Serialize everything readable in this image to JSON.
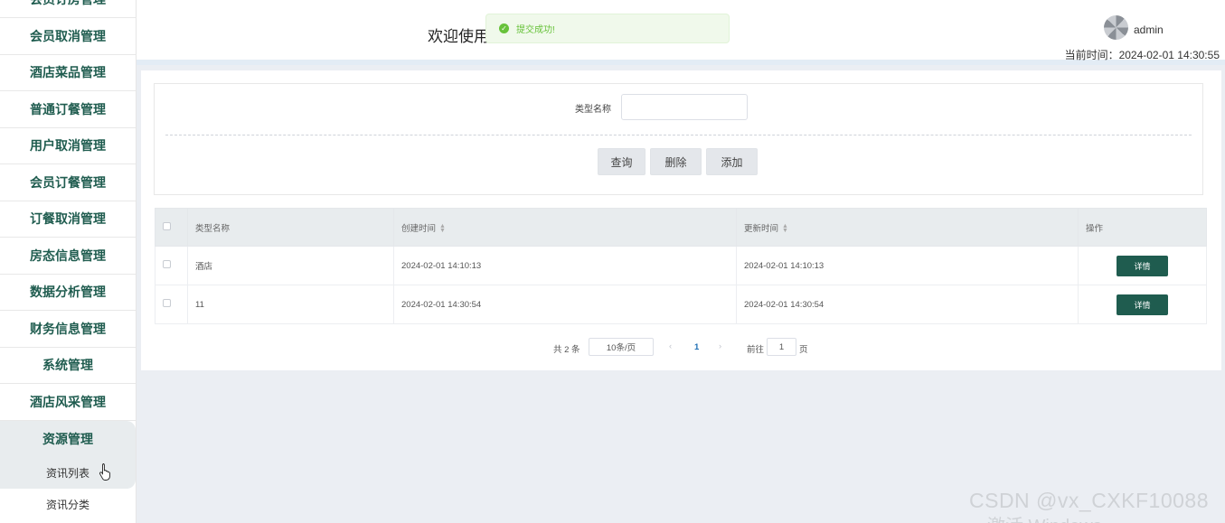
{
  "sidebar": {
    "items": [
      {
        "label": "会员订房管理"
      },
      {
        "label": "会员取消管理"
      },
      {
        "label": "酒店菜品管理"
      },
      {
        "label": "普通订餐管理"
      },
      {
        "label": "用户取消管理"
      },
      {
        "label": "会员订餐管理"
      },
      {
        "label": "订餐取消管理"
      },
      {
        "label": "房态信息管理"
      },
      {
        "label": "数据分析管理"
      },
      {
        "label": "财务信息管理"
      },
      {
        "label": "系统管理"
      },
      {
        "label": "酒店风采管理"
      },
      {
        "label": "资源管理"
      }
    ],
    "sub_items": [
      {
        "label": "资讯列表"
      },
      {
        "label": "资讯分类"
      }
    ]
  },
  "header": {
    "welcome": "欢迎使用",
    "toast": "提交成功!",
    "user": "admin",
    "clock": "当前时间：2024-02-01 14:30:55"
  },
  "search": {
    "label": "类型名称",
    "value": "",
    "buttons": {
      "query": "查询",
      "delete": "删除",
      "add": "添加"
    }
  },
  "table": {
    "columns": [
      "类型名称",
      "创建时间",
      "更新时间",
      "操作"
    ],
    "rows": [
      {
        "name": "酒店",
        "created": "2024-02-01 14:10:13",
        "updated": "2024-02-01 14:10:13",
        "action": "详情"
      },
      {
        "name": "11",
        "created": "2024-02-01 14:30:54",
        "updated": "2024-02-01 14:30:54",
        "action": "详情"
      }
    ]
  },
  "pagination": {
    "total": "共 2 条",
    "page_size": "10条/页",
    "current": "1",
    "goto_label": "前往",
    "goto_value": "1",
    "page_unit": "页"
  },
  "watermark": {
    "line1": "CSDN @vx_CXKF10088",
    "line2": "激活 Windows"
  },
  "colors": {
    "accent": "#1f5c4f",
    "success": "#67c23a"
  }
}
